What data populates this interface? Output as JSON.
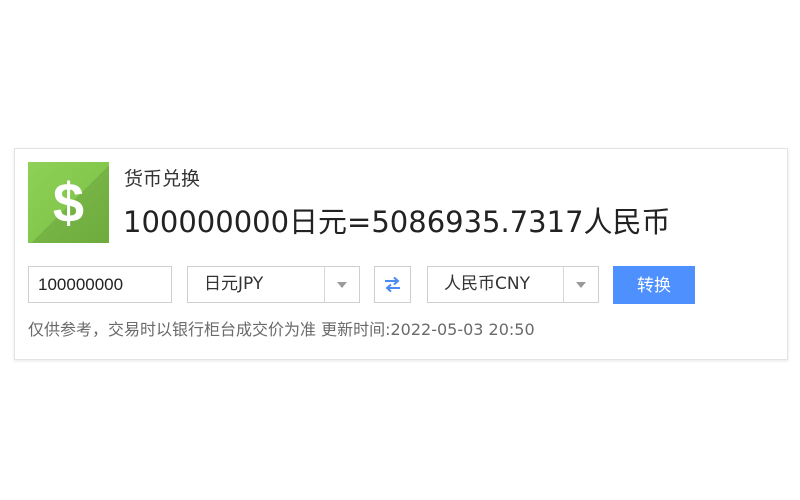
{
  "widget": {
    "icon": "dollar-sign-icon",
    "logo_glyph": "$",
    "title": "货币兑换",
    "result": "100000000日元=5086935.7317人民币",
    "amount_value": "100000000",
    "from_currency": "日元JPY",
    "to_currency": "人民币CNY",
    "swap_icon": "swap-arrows-icon",
    "convert_label": "转换",
    "note": "仅供参考，交易时以银行柜台成交价为准 更新时间:2022-05-03 20:50"
  },
  "colors": {
    "logo_green": "#8fd158",
    "button_blue": "#4d90fe",
    "swap_blue": "#4a8af4"
  }
}
